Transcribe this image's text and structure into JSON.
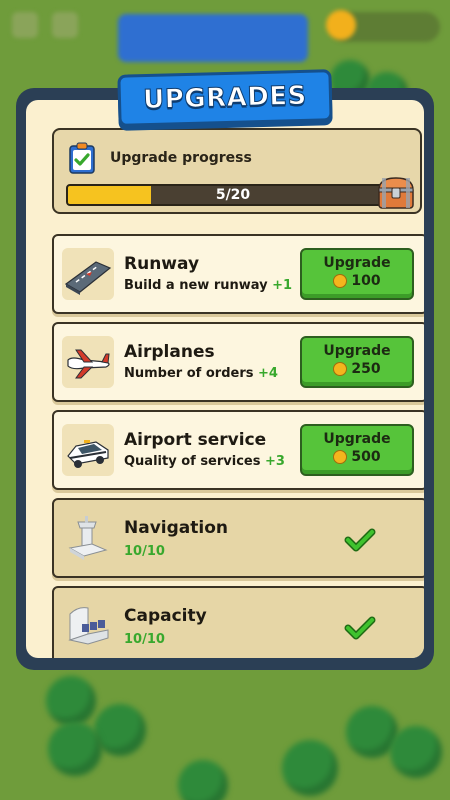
{
  "title": "UPGRADES",
  "progress": {
    "label": "Upgrade progress",
    "text": "5/20",
    "current": 5,
    "total": 20,
    "fill_color": "#f6c31f"
  },
  "upgrades": [
    {
      "name": "Runway",
      "desc": "Build a new runway",
      "bonus": "+1",
      "button": "Upgrade",
      "cost": "100",
      "icon": "runway-icon"
    },
    {
      "name": "Airplanes",
      "desc": "Number of orders",
      "bonus": "+4",
      "button": "Upgrade",
      "cost": "250",
      "icon": "airplane-icon"
    },
    {
      "name": "Airport service",
      "desc": "Quality of services",
      "bonus": "+3",
      "button": "Upgrade",
      "cost": "500",
      "icon": "service-car-icon"
    }
  ],
  "completed": [
    {
      "name": "Navigation",
      "level": "10/10",
      "icon": "control-tower-icon"
    },
    {
      "name": "Capacity",
      "level": "10/10",
      "icon": "terminal-seats-icon"
    }
  ],
  "colors": {
    "accent": "#56c43a",
    "banner": "#1f83e6",
    "panel": "#2b3f55"
  }
}
